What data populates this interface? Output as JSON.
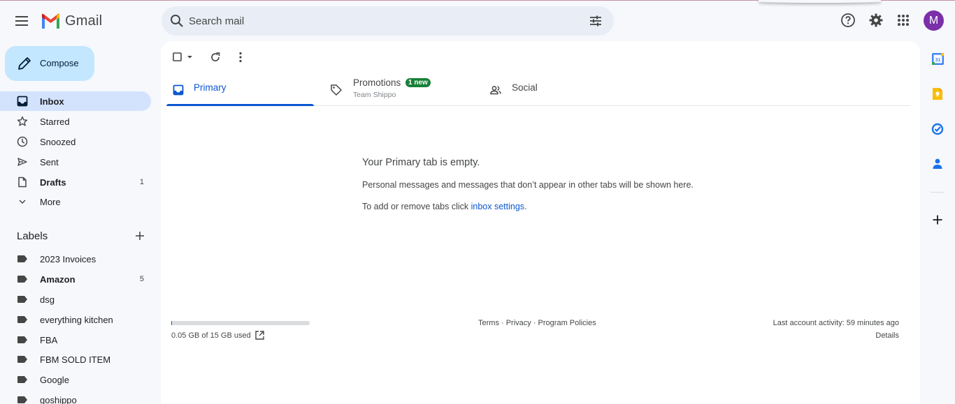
{
  "app": {
    "name": "Gmail"
  },
  "search": {
    "placeholder": "Search mail"
  },
  "user": {
    "avatar_letter": "M",
    "avatar_color": "#7b2fa8"
  },
  "compose": {
    "label": "Compose"
  },
  "nav": [
    {
      "label": "Inbox",
      "count": "",
      "bold": true,
      "active": true,
      "icon": "inbox-icon"
    },
    {
      "label": "Starred",
      "count": "",
      "bold": false,
      "active": false,
      "icon": "star-icon"
    },
    {
      "label": "Snoozed",
      "count": "",
      "bold": false,
      "active": false,
      "icon": "clock-icon"
    },
    {
      "label": "Sent",
      "count": "",
      "bold": false,
      "active": false,
      "icon": "send-icon"
    },
    {
      "label": "Drafts",
      "count": "1",
      "bold": true,
      "active": false,
      "icon": "draft-icon"
    },
    {
      "label": "More",
      "count": "",
      "bold": false,
      "active": false,
      "icon": "chevron-down-icon"
    }
  ],
  "labels": {
    "title": "Labels",
    "items": [
      {
        "label": "2023 Invoices",
        "count": "",
        "bold": false
      },
      {
        "label": "Amazon",
        "count": "5",
        "bold": true
      },
      {
        "label": "dsg",
        "count": "",
        "bold": false
      },
      {
        "label": "everything kitchen",
        "count": "",
        "bold": false
      },
      {
        "label": "FBA",
        "count": "",
        "bold": false
      },
      {
        "label": "FBM SOLD ITEM",
        "count": "",
        "bold": false
      },
      {
        "label": "Google",
        "count": "",
        "bold": false
      },
      {
        "label": "goshippo",
        "count": "",
        "bold": false
      }
    ]
  },
  "tabs": {
    "primary": {
      "label": "Primary"
    },
    "promotions": {
      "label": "Promotions",
      "badge": "1 new",
      "subtitle": "Team Shippo"
    },
    "social": {
      "label": "Social"
    }
  },
  "empty_state": {
    "title": "Your Primary tab is empty.",
    "description": "Personal messages and messages that don’t appear in other tabs will be shown here.",
    "hint_prefix": "To add or remove tabs click ",
    "hint_link": "inbox settings",
    "hint_suffix": "."
  },
  "footer": {
    "storage_text": "0.05 GB of 15 GB used",
    "storage_fraction": 0.0033,
    "links": "Terms · Privacy · Program Policies",
    "activity": "Last account activity: 59 minutes ago",
    "details": "Details"
  },
  "colors": {
    "accent": "#0b57d0",
    "compose_bg": "#c2e7ff",
    "active_nav_bg": "#d3e3fd",
    "badge_green": "#188038"
  }
}
